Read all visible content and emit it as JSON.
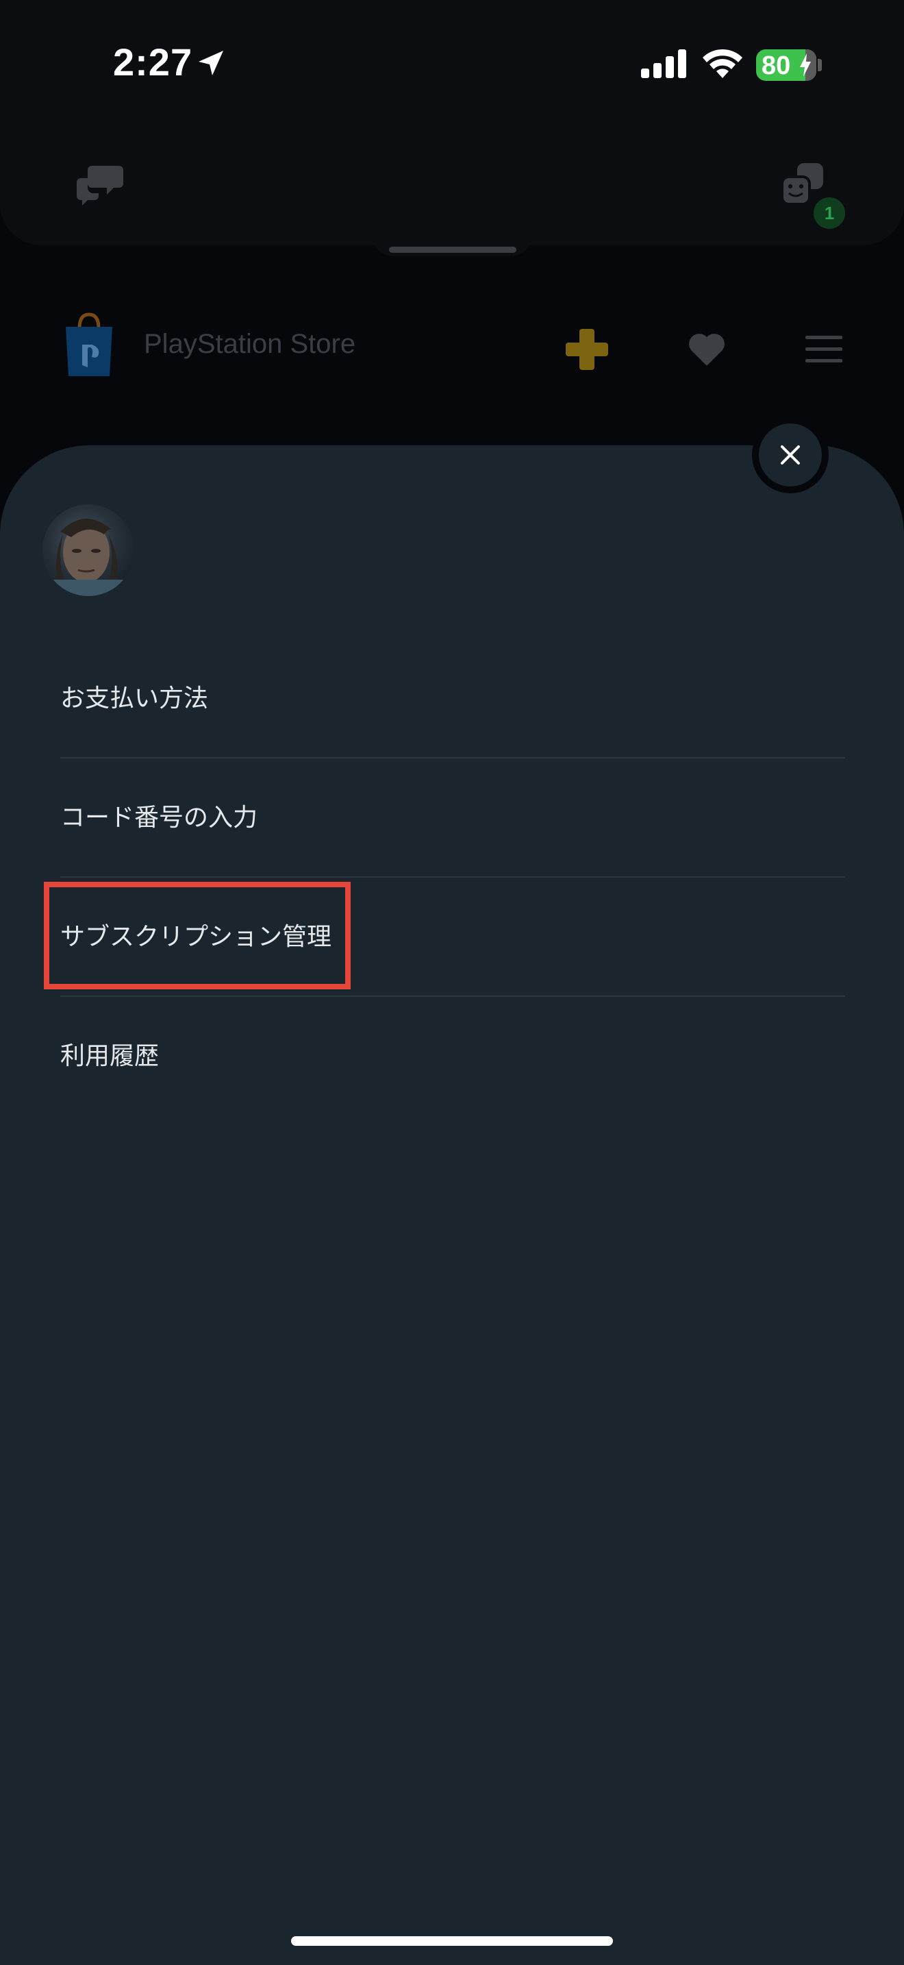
{
  "status_bar": {
    "time": "2:27",
    "battery": "80"
  },
  "top_bar": {
    "party_badge_count": "1"
  },
  "store_header": {
    "title": "PlayStation Store"
  },
  "menu": {
    "items": [
      {
        "label": "お支払い方法"
      },
      {
        "label": "コード番号の入力"
      },
      {
        "label": "サブスクリプション管理"
      },
      {
        "label": "利用履歴"
      }
    ]
  },
  "colors": {
    "sheet_background": "#1b252d",
    "highlight": "#e6453a",
    "battery": "#3fc24d",
    "ps_plus": "#c9a31c",
    "ps_blue": "#0a5ea6"
  }
}
